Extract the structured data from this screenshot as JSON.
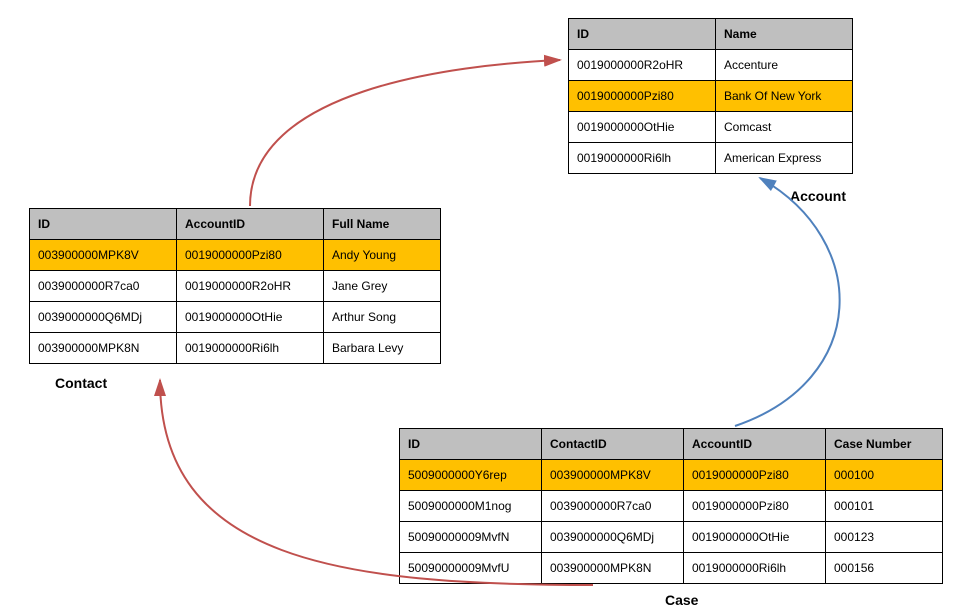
{
  "account": {
    "caption": "Account",
    "headers": [
      "ID",
      "Name"
    ],
    "rows": [
      {
        "id": "0019000000R2oHR",
        "name": "Accenture",
        "hl": false
      },
      {
        "id": "0019000000Pzi80",
        "name": "Bank Of New York",
        "hl": true
      },
      {
        "id": "0019000000OtHie",
        "name": "Comcast",
        "hl": false
      },
      {
        "id": "0019000000Ri6lh",
        "name": "American Express",
        "hl": false
      }
    ]
  },
  "contact": {
    "caption": "Contact",
    "headers": [
      "ID",
      "AccountID",
      "Full Name"
    ],
    "rows": [
      {
        "id": "003900000MPK8V",
        "accountId": "0019000000Pzi80",
        "fullName": "Andy Young",
        "hl": true
      },
      {
        "id": "0039000000R7ca0",
        "accountId": "0019000000R2oHR",
        "fullName": "Jane Grey",
        "hl": false
      },
      {
        "id": "0039000000Q6MDj",
        "accountId": "0019000000OtHie",
        "fullName": "Arthur Song",
        "hl": false
      },
      {
        "id": "003900000MPK8N",
        "accountId": "0019000000Ri6lh",
        "fullName": "Barbara Levy",
        "hl": false
      }
    ]
  },
  "case": {
    "caption": "Case",
    "headers": [
      "ID",
      "ContactID",
      "AccountID",
      "Case Number"
    ],
    "rows": [
      {
        "id": "5009000000Y6rep",
        "contactId": "003900000MPK8V",
        "accountId": "0019000000Pzi80",
        "caseNumber": "000100",
        "hl": true
      },
      {
        "id": "5009000000M1nog",
        "contactId": "0039000000R7ca0",
        "accountId": "0019000000Pzi80",
        "caseNumber": "000101",
        "hl": false
      },
      {
        "id": "50090000009MvfN",
        "contactId": "0039000000Q6MDj",
        "accountId": "0019000000OtHie",
        "caseNumber": "000123",
        "hl": false
      },
      {
        "id": "50090000009MvfU",
        "contactId": "003900000MPK8N",
        "accountId": "0019000000Ri6lh",
        "caseNumber": "000156",
        "hl": false
      }
    ]
  }
}
